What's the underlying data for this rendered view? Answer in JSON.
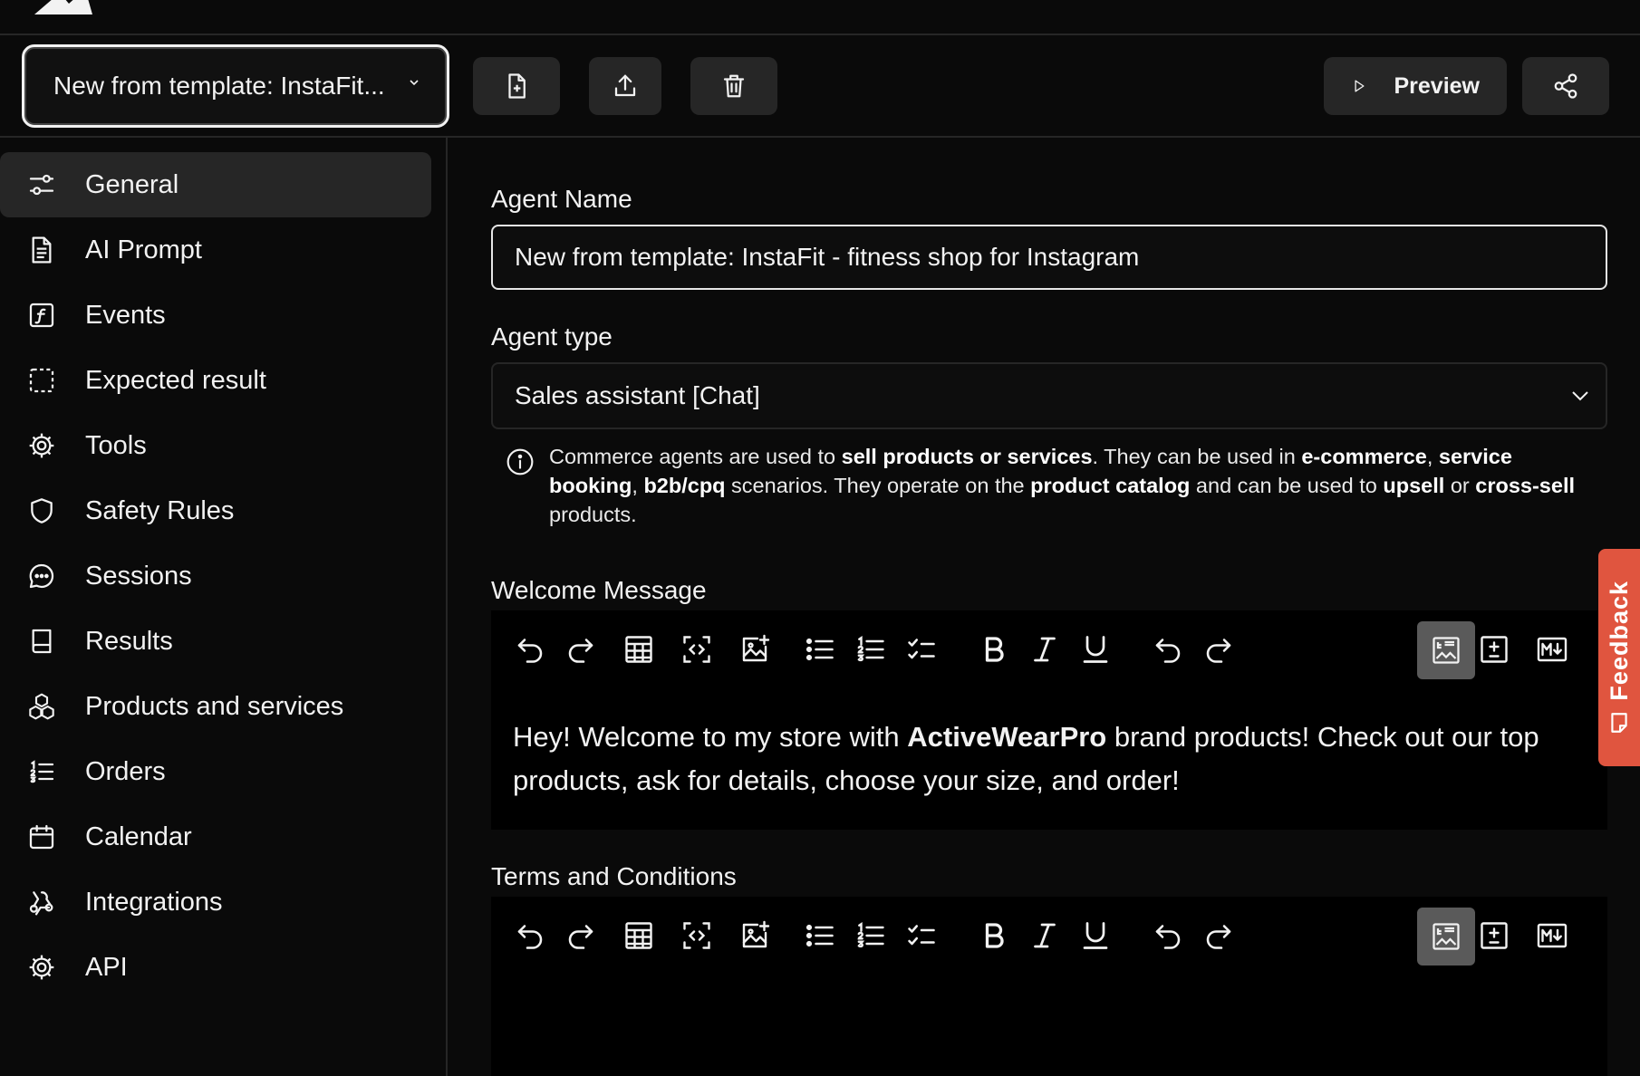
{
  "toolbar": {
    "agent_selector": "New from template: InstaFit...",
    "preview_label": "Preview"
  },
  "sidebar": {
    "items": [
      {
        "label": "General",
        "icon": "sliders-icon",
        "active": true
      },
      {
        "label": "AI Prompt",
        "icon": "document-icon"
      },
      {
        "label": "Events",
        "icon": "function-icon"
      },
      {
        "label": "Expected result",
        "icon": "dashed-square-icon"
      },
      {
        "label": "Tools",
        "icon": "cog-icon"
      },
      {
        "label": "Safety Rules",
        "icon": "shield-icon"
      },
      {
        "label": "Sessions",
        "icon": "chat-bubble-icon"
      },
      {
        "label": "Results",
        "icon": "book-icon"
      },
      {
        "label": "Products and services",
        "icon": "cubes-icon"
      },
      {
        "label": "Orders",
        "icon": "numbered-list-icon"
      },
      {
        "label": "Calendar",
        "icon": "calendar-icon"
      },
      {
        "label": "Integrations",
        "icon": "webhook-icon"
      },
      {
        "label": "API",
        "icon": "cog-icon"
      }
    ]
  },
  "form": {
    "agent_name_label": "Agent Name",
    "agent_name_value": "New from template: InstaFit - fitness shop for Instagram",
    "agent_type_label": "Agent type",
    "agent_type_value": "Sales assistant [Chat]",
    "info": {
      "t1": "Commerce agents are used to ",
      "b1": "sell products or services",
      "t2": ". They can be used in ",
      "b2": "e-commerce",
      "t3": ", ",
      "b3": "service booking",
      "t4": ", ",
      "b4": "b2b/cpq",
      "t5": " scenarios. They operate on the ",
      "b5": "product catalog",
      "t6": " and can be used to ",
      "b6": "upsell",
      "t7": " or ",
      "b7": "cross-sell",
      "t8": " products."
    },
    "welcome_label": "Welcome Message",
    "welcome": {
      "t1": "Hey! Welcome to my store with ",
      "b1": "ActiveWearPro",
      "t2": " brand products! Check out our top products, ask for details, choose your size, and order!"
    },
    "terms_label": "Terms and Conditions"
  },
  "feedback_label": "Feedback",
  "colors": {
    "background": "#0a0a0a",
    "surface": "#262626",
    "feedback": "#e0553f"
  }
}
